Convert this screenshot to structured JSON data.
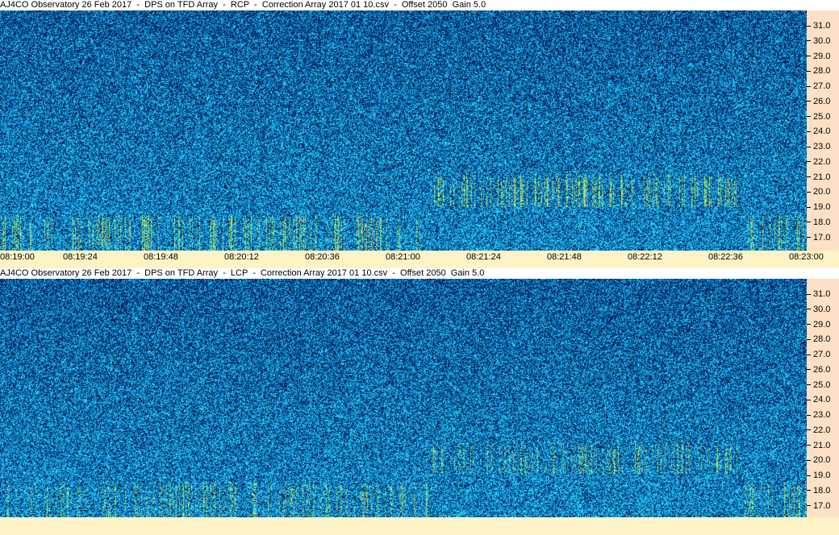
{
  "panels": [
    {
      "id": "rcp",
      "title": "AJ4CO Observatory 26 Feb 2017  -  DPS on TFD Array  -  RCP  -  Correction Array 2017 01 10.csv  -  Offset 2050  Gain 5.0",
      "y_ticks": [
        "31.0",
        "30.0",
        "29.0",
        "28.0",
        "27.0",
        "26.0",
        "25.0",
        "24.0",
        "23.0",
        "22.0",
        "21.0",
        "20.0",
        "19.0",
        "18.0",
        "17.0"
      ]
    },
    {
      "id": "lcp",
      "title": "AJ4CO Observatory 26 Feb 2017  -  DPS on TFD Array  -  LCP  -  Correction Array 2017 01 10.csv  -  Offset 2050  Gain 5.0",
      "y_ticks": [
        "31.0",
        "30.0",
        "29.0",
        "28.0",
        "27.0",
        "26.0",
        "25.0",
        "24.0",
        "23.0",
        "22.0",
        "21.0",
        "20.0",
        "19.0",
        "18.0",
        "17.0"
      ]
    }
  ],
  "x_ticks": [
    "08:19:00",
    "08:19:24",
    "08:19:48",
    "08:20:12",
    "08:20:36",
    "08:21:00",
    "08:21:24",
    "08:21:48",
    "08:22:12",
    "08:22:36",
    "08:23:00"
  ],
  "colors": {
    "noise_dark": "#0a1a5a",
    "noise_mid": "#1565c0",
    "noise_light": "#29b6f6",
    "burst": "#c6e84a",
    "burst_hot": "#ff7043",
    "y_axis_bg": "#fde1c6",
    "x_axis_bg": "#fdf3c6"
  }
}
